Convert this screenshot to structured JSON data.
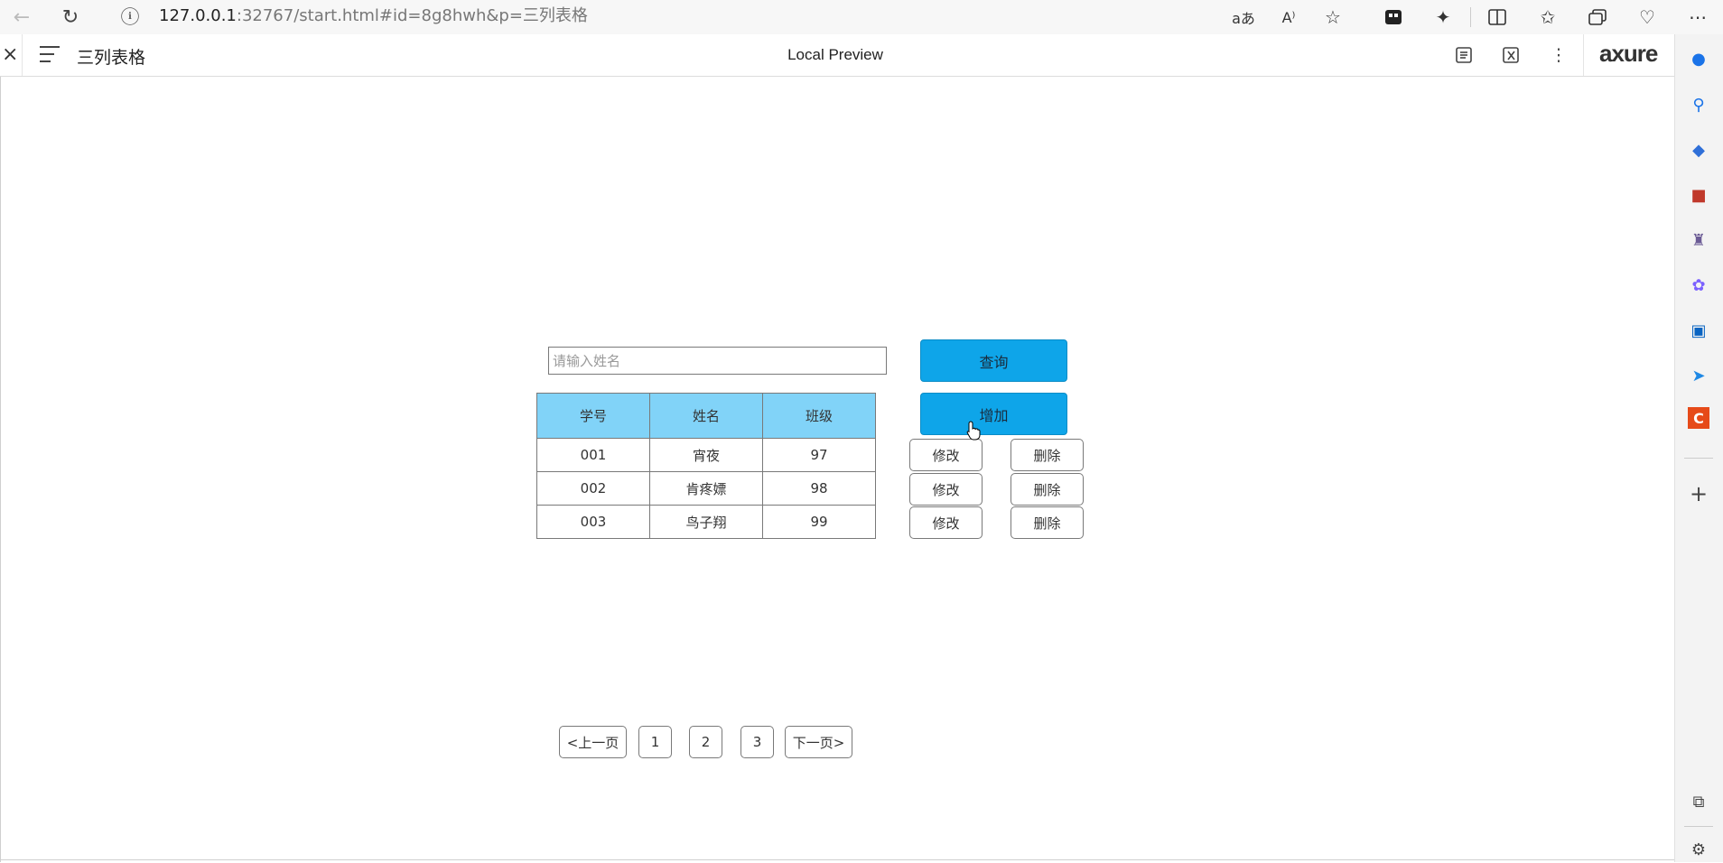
{
  "browser": {
    "url_host": "127.0.0.1",
    "url_rest": ":32767/start.html#id=8g8hwh&p=三列表格"
  },
  "axure": {
    "close_glyph": "×",
    "page_title": "三列表格",
    "center_title": "Local Preview",
    "logo": "axure"
  },
  "form": {
    "search_placeholder": "请输入姓名",
    "search_value": "",
    "query_label": "查询",
    "add_label": "增加"
  },
  "table": {
    "headers": [
      "学号",
      "姓名",
      "班级"
    ],
    "rows": [
      {
        "id": "001",
        "name": "宵夜",
        "class": "97",
        "edit": "修改",
        "delete": "删除"
      },
      {
        "id": "002",
        "name": "肯疼嫖",
        "class": "98",
        "edit": "修改",
        "delete": "删除"
      },
      {
        "id": "003",
        "name": "鸟子翔",
        "class": "99",
        "edit": "修改",
        "delete": "删除"
      }
    ]
  },
  "pagination": {
    "prev": "<上一页",
    "pages": [
      "1",
      "2",
      "3"
    ],
    "next": "下一页>"
  },
  "colors": {
    "primary_button": "#0ea5e9",
    "table_header": "#81d3f8",
    "border": "#797979"
  }
}
